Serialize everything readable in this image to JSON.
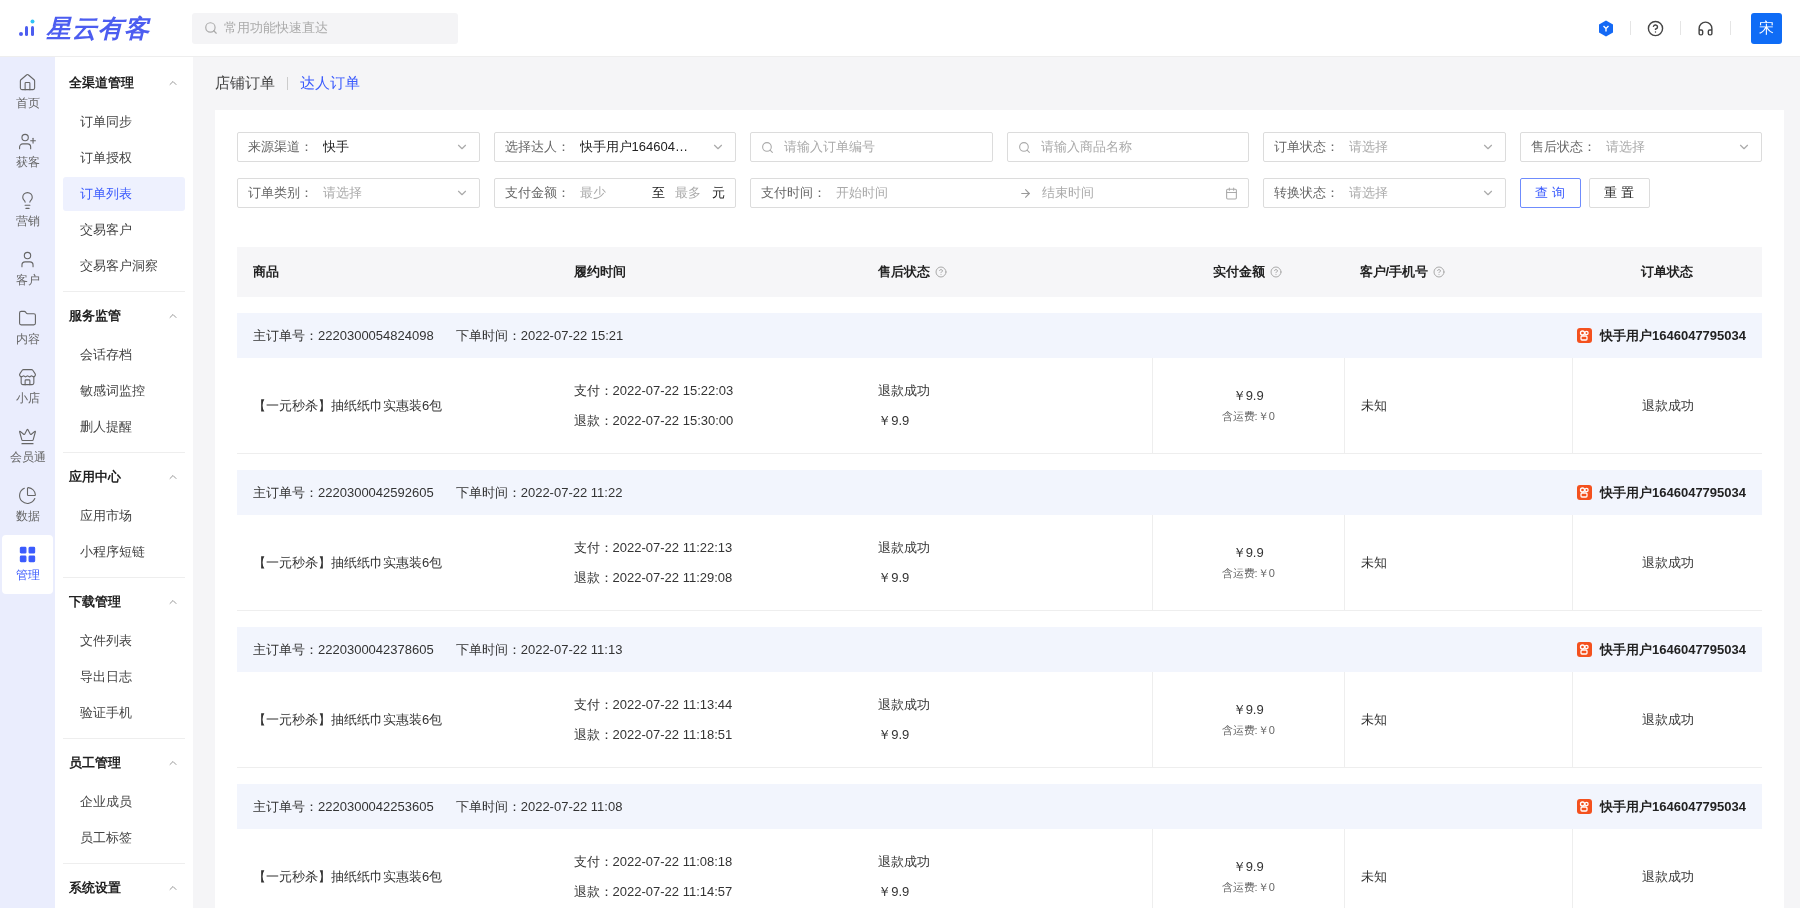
{
  "app": {
    "logo": "星云有客",
    "search_placeholder": "常用功能快速直达",
    "avatar": "宋"
  },
  "rail": [
    {
      "label": "首页",
      "selected": false
    },
    {
      "label": "获客",
      "selected": false
    },
    {
      "label": "营销",
      "selected": false
    },
    {
      "label": "客户",
      "selected": false
    },
    {
      "label": "内容",
      "selected": false
    },
    {
      "label": "小店",
      "selected": false
    },
    {
      "label": "会员通",
      "selected": false
    },
    {
      "label": "数据",
      "selected": false
    },
    {
      "label": "管理",
      "selected": true
    }
  ],
  "menu": [
    {
      "title": "全渠道管理",
      "expanded": true,
      "items": [
        {
          "label": "订单同步",
          "selected": false
        },
        {
          "label": "订单授权",
          "selected": false
        },
        {
          "label": "订单列表",
          "selected": true
        },
        {
          "label": "交易客户",
          "selected": false
        },
        {
          "label": "交易客户洞察",
          "selected": false
        }
      ]
    },
    {
      "title": "服务监管",
      "expanded": true,
      "items": [
        {
          "label": "会话存档",
          "selected": false
        },
        {
          "label": "敏感词监控",
          "selected": false
        },
        {
          "label": "删人提醒",
          "selected": false
        }
      ]
    },
    {
      "title": "应用中心",
      "expanded": true,
      "items": [
        {
          "label": "应用市场",
          "selected": false
        },
        {
          "label": "小程序短链",
          "selected": false
        }
      ]
    },
    {
      "title": "下载管理",
      "expanded": true,
      "items": [
        {
          "label": "文件列表",
          "selected": false
        },
        {
          "label": "导出日志",
          "selected": false
        },
        {
          "label": "验证手机",
          "selected": false
        }
      ]
    },
    {
      "title": "员工管理",
      "expanded": true,
      "items": [
        {
          "label": "企业成员",
          "selected": false
        },
        {
          "label": "员工标签",
          "selected": false
        }
      ]
    },
    {
      "title": "系统设置",
      "expanded": true
    }
  ],
  "tabs": [
    {
      "label": "店铺订单",
      "selected": false
    },
    {
      "label": "达人订单",
      "selected": true
    }
  ],
  "filters": [
    {
      "kind": "select",
      "label": "来源渠道：",
      "value": "快手"
    },
    {
      "kind": "select",
      "label": "选择达人：",
      "value": "快手用户164604…"
    },
    {
      "kind": "search",
      "placeholder": "请输入订单编号"
    },
    {
      "kind": "search",
      "placeholder": "请输入商品名称"
    },
    {
      "kind": "select",
      "label": "订单状态：",
      "placeholder": "请选择"
    },
    {
      "kind": "select",
      "label": "售后状态：",
      "placeholder": "请选择"
    },
    {
      "kind": "select",
      "label": "订单类别：",
      "placeholder": "请选择"
    },
    {
      "kind": "range",
      "label": "支付金额：",
      "placeholder_min": "最少",
      "separator": "至",
      "placeholder_max": "最多",
      "unit": "元"
    },
    {
      "kind": "date",
      "label": "支付时间：",
      "placeholder_start": "开始时间",
      "placeholder_end": "结束时间"
    },
    {
      "kind": "select",
      "label": "转换状态：",
      "placeholder": "请选择"
    }
  ],
  "buttons": [
    {
      "label": "查 询",
      "kind": "primary"
    },
    {
      "label": "重 置",
      "kind": "default"
    }
  ],
  "table": {
    "columns": [
      {
        "label": "商品",
        "help": false
      },
      {
        "label": "履约时间",
        "help": false
      },
      {
        "label": "售后状态",
        "help": true
      },
      {
        "label": "实付金额",
        "help": true
      },
      {
        "label": "客户/手机号",
        "help": true
      },
      {
        "label": "订单状态",
        "help": false
      }
    ],
    "orders": [
      {
        "order_no_label": "主订单号：",
        "order_no": "2220300054824098",
        "time_label": "下单时间：",
        "time": "2022-07-22 15:21",
        "shop": "快手用户1646047795034",
        "product": "【一元秒杀】抽纸纸巾实惠装6包",
        "pay_label": "支付：",
        "pay_time": "2022-07-22 15:22:03",
        "refund_label": "退款：",
        "refund_time": "2022-07-22 15:30:00",
        "after_sale": "退款成功",
        "after_sale_amount": "￥9.9",
        "amount": "￥9.9",
        "shipping": "含运费:￥0",
        "customer": "未知",
        "status": "退款成功"
      },
      {
        "order_no_label": "主订单号：",
        "order_no": "2220300042592605",
        "time_label": "下单时间：",
        "time": "2022-07-22 11:22",
        "shop": "快手用户1646047795034",
        "product": "【一元秒杀】抽纸纸巾实惠装6包",
        "pay_label": "支付：",
        "pay_time": "2022-07-22 11:22:13",
        "refund_label": "退款：",
        "refund_time": "2022-07-22 11:29:08",
        "after_sale": "退款成功",
        "after_sale_amount": "￥9.9",
        "amount": "￥9.9",
        "shipping": "含运费:￥0",
        "customer": "未知",
        "status": "退款成功"
      },
      {
        "order_no_label": "主订单号：",
        "order_no": "2220300042378605",
        "time_label": "下单时间：",
        "time": "2022-07-22 11:13",
        "shop": "快手用户1646047795034",
        "product": "【一元秒杀】抽纸纸巾实惠装6包",
        "pay_label": "支付：",
        "pay_time": "2022-07-22 11:13:44",
        "refund_label": "退款：",
        "refund_time": "2022-07-22 11:18:51",
        "after_sale": "退款成功",
        "after_sale_amount": "￥9.9",
        "amount": "￥9.9",
        "shipping": "含运费:￥0",
        "customer": "未知",
        "status": "退款成功"
      },
      {
        "order_no_label": "主订单号：",
        "order_no": "2220300042253605",
        "time_label": "下单时间：",
        "time": "2022-07-22 11:08",
        "shop": "快手用户1646047795034",
        "product": "【一元秒杀】抽纸纸巾实惠装6包",
        "pay_label": "支付：",
        "pay_time": "2022-07-22 11:08:18",
        "refund_label": "退款：",
        "refund_time": "2022-07-22 11:14:57",
        "after_sale": "退款成功",
        "after_sale_amount": "￥9.9",
        "amount": "￥9.9",
        "shipping": "含运费:￥0",
        "customer": "未知",
        "status": "退款成功"
      }
    ]
  }
}
